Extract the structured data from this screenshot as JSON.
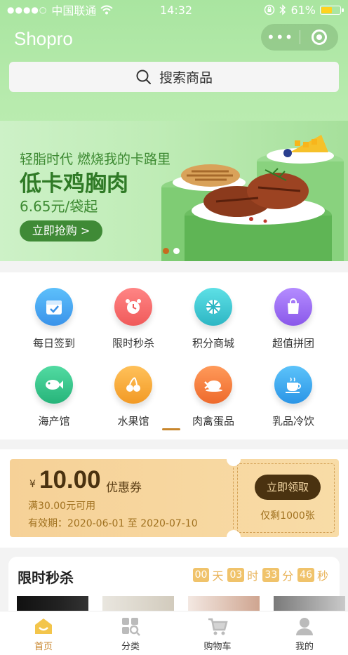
{
  "status_bar": {
    "carrier": "中国联通",
    "time": "14:32",
    "battery": "61%",
    "battery_level": 0.61
  },
  "nav": {
    "title": "Shopro",
    "more_label": "•••"
  },
  "search": {
    "placeholder": "搜索商品"
  },
  "banner": {
    "subtitle": "轻脂时代 燃烧我的卡路里",
    "title": "低卡鸡胸肉",
    "price": "6.65元/袋起",
    "button": "立即抢购 >",
    "active_dot": 0,
    "dot_count": 2
  },
  "categories": [
    {
      "label": "每日签到",
      "icon": "calendar-check-icon",
      "color": "#49a9f2"
    },
    {
      "label": "限时秒杀",
      "icon": "alarm-clock-icon",
      "color": "#f56b6b"
    },
    {
      "label": "积分商城",
      "icon": "candy-icon",
      "color": "#3ec8d2"
    },
    {
      "label": "超值拼团",
      "icon": "bag-icon",
      "color": "#9d6bf0"
    },
    {
      "label": "海产馆",
      "icon": "fish-icon",
      "color": "#35c38b"
    },
    {
      "label": "水果馆",
      "icon": "cherry-icon",
      "color": "#f5a833"
    },
    {
      "label": "肉禽蛋品",
      "icon": "chicken-icon",
      "color": "#f27b3a"
    },
    {
      "label": "乳品冷饮",
      "icon": "coffee-cup-icon",
      "color": "#37a8ec"
    }
  ],
  "coupon": {
    "currency": "¥",
    "amount": "10.00",
    "type": "优惠券",
    "condition": "满30.00元可用",
    "validity": "有效期：2020-06-01 至 2020-07-10",
    "button": "立即领取",
    "remaining": "仅剩1000张"
  },
  "flash_sale": {
    "title": "限时秒杀",
    "countdown": [
      {
        "value": "00",
        "unit": "天"
      },
      {
        "value": "03",
        "unit": "时"
      },
      {
        "value": "33",
        "unit": "分"
      },
      {
        "value": "46",
        "unit": "秒"
      }
    ]
  },
  "tabbar": [
    {
      "label": "首页",
      "icon": "home-icon",
      "active": true
    },
    {
      "label": "分类",
      "icon": "category-icon",
      "active": false
    },
    {
      "label": "购物车",
      "icon": "cart-icon",
      "active": false
    },
    {
      "label": "我的",
      "icon": "user-icon",
      "active": false
    }
  ],
  "colors": {
    "accent": "#c8862c",
    "header_green": "#a9e5a0",
    "coupon_gold": "#f6d197"
  }
}
